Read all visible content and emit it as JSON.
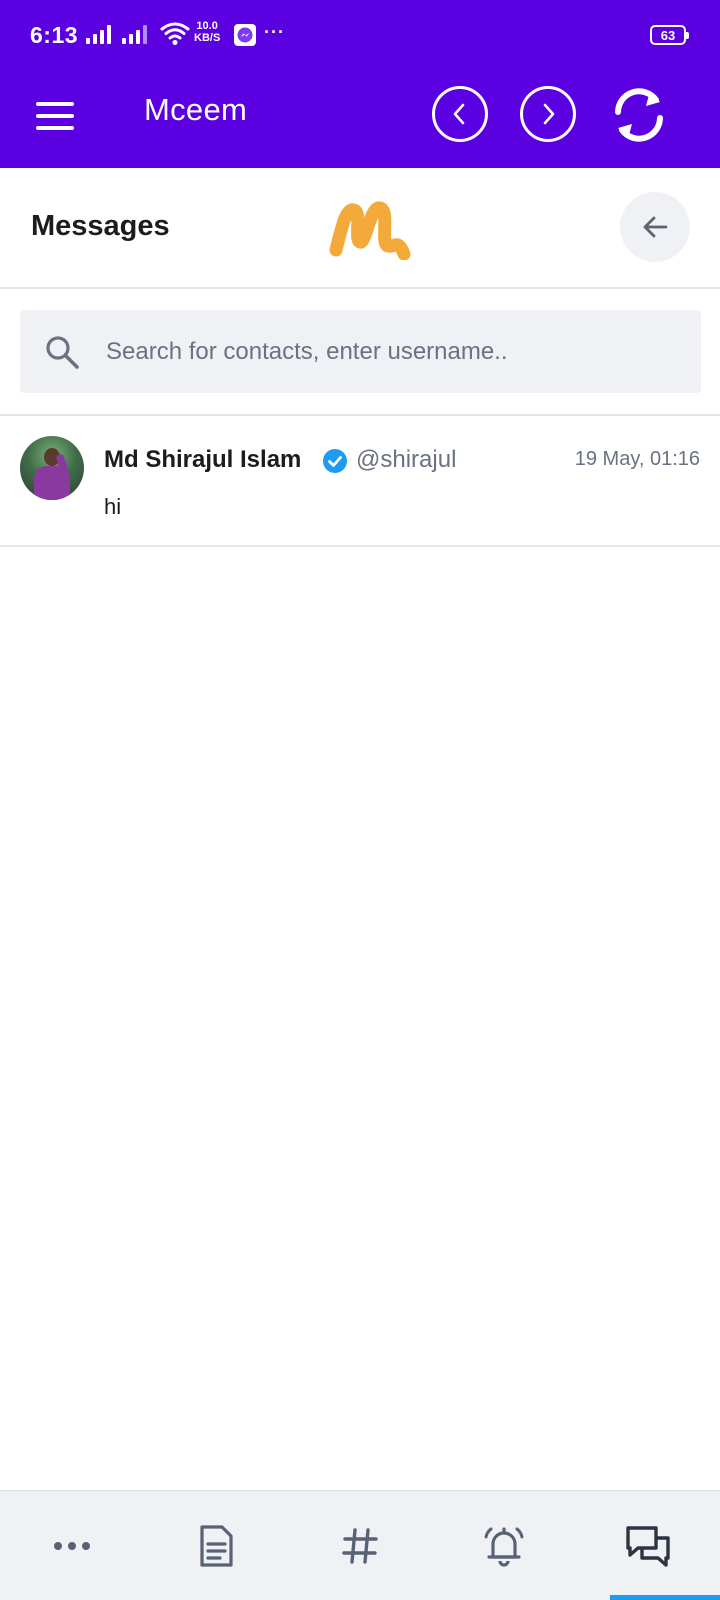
{
  "status_bar": {
    "time": "6:13",
    "speed_value": "10.0",
    "speed_unit": "KB/S",
    "overflow": "···",
    "battery": "63"
  },
  "app_bar": {
    "title": "Mceem"
  },
  "messages_header": {
    "title": "Messages"
  },
  "search": {
    "placeholder": "Search for contacts, enter username.."
  },
  "conversations": [
    {
      "name": "Md Shirajul Islam",
      "handle": "@shirajul",
      "time": "19 May, 01:16",
      "last_message": "hi",
      "verified": true
    }
  ],
  "bottom_nav": {
    "items": [
      "more-icon",
      "document-icon",
      "hashtag-icon",
      "bell-icon",
      "chat-icon"
    ],
    "active": "chat-icon"
  },
  "colors": {
    "primary": "#5b00e0",
    "logo": "#f4a93b",
    "verified": "#1d9bf0",
    "active_tab": "#1a9cf0",
    "muted_text": "#6a7180",
    "surface": "#eff1f5"
  }
}
